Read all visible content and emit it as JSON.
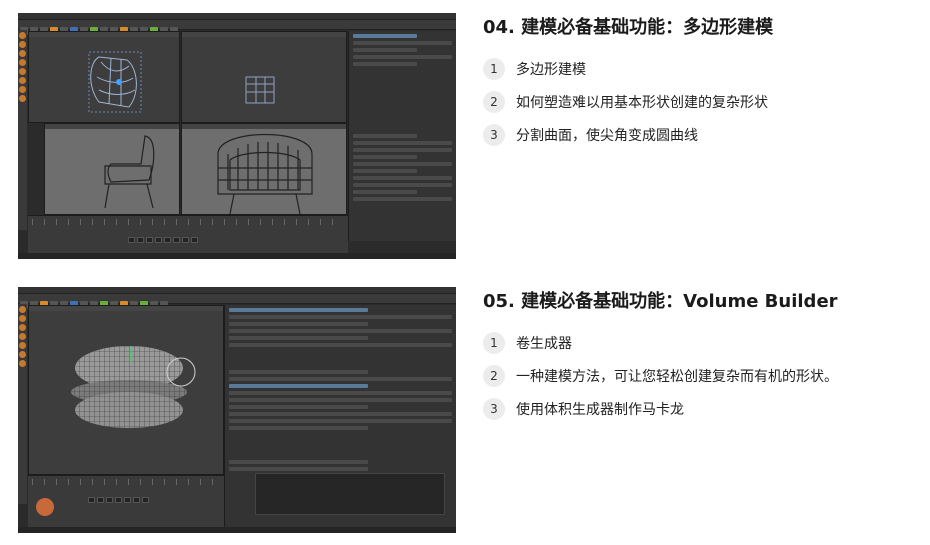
{
  "sections": [
    {
      "title": "04. 建模必备基础功能：多边形建模",
      "items": [
        {
          "num": "1",
          "text": "多边形建模"
        },
        {
          "num": "2",
          "text": "如何塑造难以用基本形状创建的复杂形状"
        },
        {
          "num": "3",
          "text": "分割曲面，使尖角变成圆曲线"
        }
      ]
    },
    {
      "title": "05. 建模必备基础功能：Volume Builder",
      "items": [
        {
          "num": "1",
          "text": "卷生成器"
        },
        {
          "num": "2",
          "text": "一种建模方法，可让您轻松创建复杂而有机的形状。"
        },
        {
          "num": "3",
          "text": "使用体积生成器制作马卡龙"
        }
      ]
    }
  ],
  "screenshots": [
    {
      "subject": "armchair polygon model in 3D software quad view"
    },
    {
      "subject": "macaron volume builder model in 3D software viewport"
    }
  ],
  "colors": {
    "accent_orange": "#d98b2b",
    "accent_green": "#6cae3c",
    "ui_dark": "#2b2b2b",
    "badge_bg": "#ececec"
  }
}
